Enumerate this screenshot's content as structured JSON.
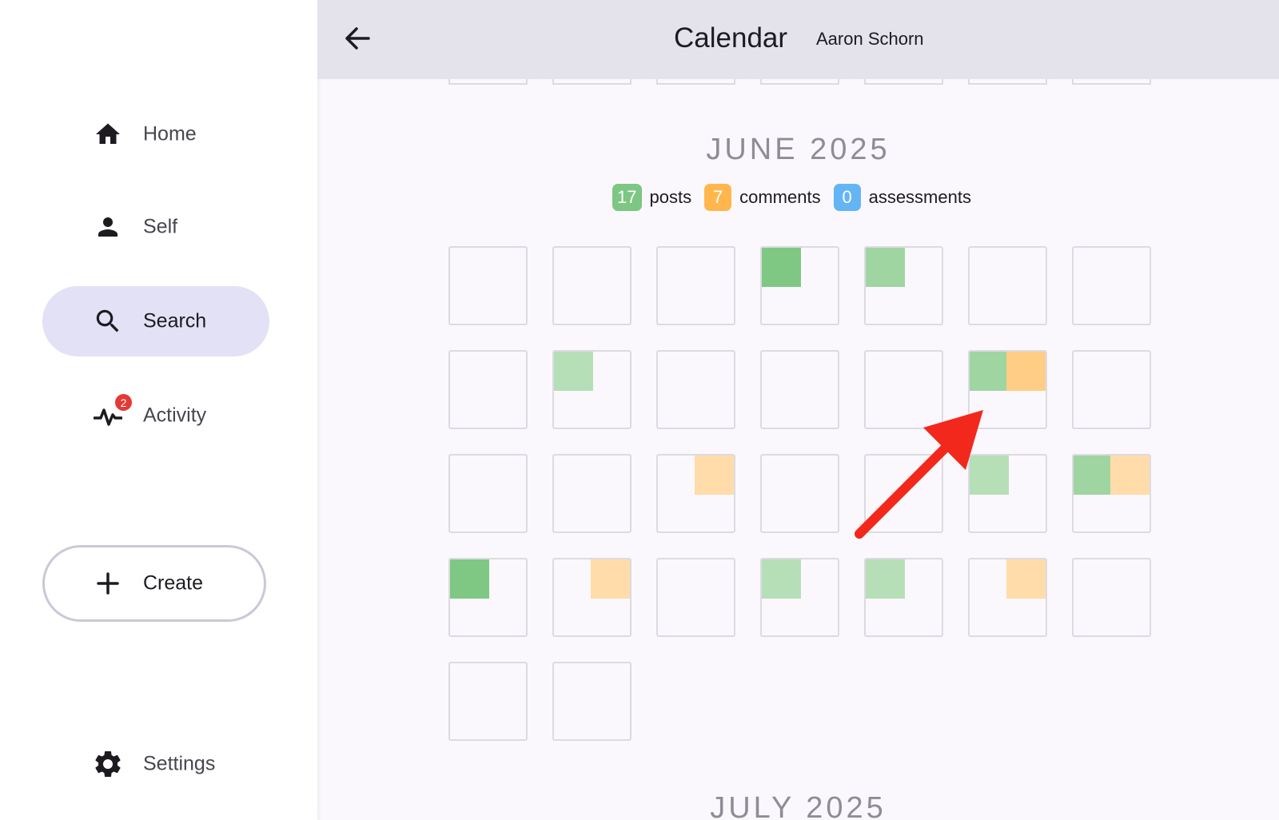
{
  "sidebar": {
    "items": [
      {
        "label": "Home",
        "icon": "home-icon"
      },
      {
        "label": "Self",
        "icon": "person-icon"
      },
      {
        "label": "Search",
        "icon": "search-icon",
        "active": true
      },
      {
        "label": "Activity",
        "icon": "activity-icon",
        "badge": "2"
      }
    ],
    "create_label": "Create",
    "settings_label": "Settings"
  },
  "header": {
    "title": "Calendar",
    "user": "Aaron Schorn"
  },
  "calendar": {
    "month": "JUNE 2025",
    "next_month": "JULY 2025",
    "stats": [
      {
        "count": "17",
        "label": "posts",
        "color": "#7dc683"
      },
      {
        "count": "7",
        "label": "comments",
        "color": "#ffb74d"
      },
      {
        "count": "0",
        "label": "assessments",
        "color": "#64b5f6"
      }
    ],
    "colors": {
      "post_strong": "#7ec884",
      "post_medium": "#9fd5a0",
      "post_light": "#b6dfb7",
      "comment_medium": "#ffcd85",
      "comment_light": "#ffdca9"
    },
    "weeks": [
      [
        null,
        null,
        null,
        {
          "post": "strong"
        },
        {
          "post": "medium"
        },
        null,
        null
      ],
      [
        null,
        {
          "post": "light"
        },
        null,
        null,
        null,
        {
          "post": "medium",
          "comment": "medium"
        },
        null
      ],
      [
        null,
        null,
        {
          "comment": "light"
        },
        null,
        null,
        {
          "post": "light"
        },
        {
          "post": "medium",
          "comment": "light"
        }
      ],
      [
        {
          "post": "strong"
        },
        {
          "comment": "light"
        },
        null,
        {
          "post": "light"
        },
        {
          "post": "light"
        },
        {
          "comment": "light"
        },
        null
      ],
      [
        null,
        null
      ]
    ]
  }
}
